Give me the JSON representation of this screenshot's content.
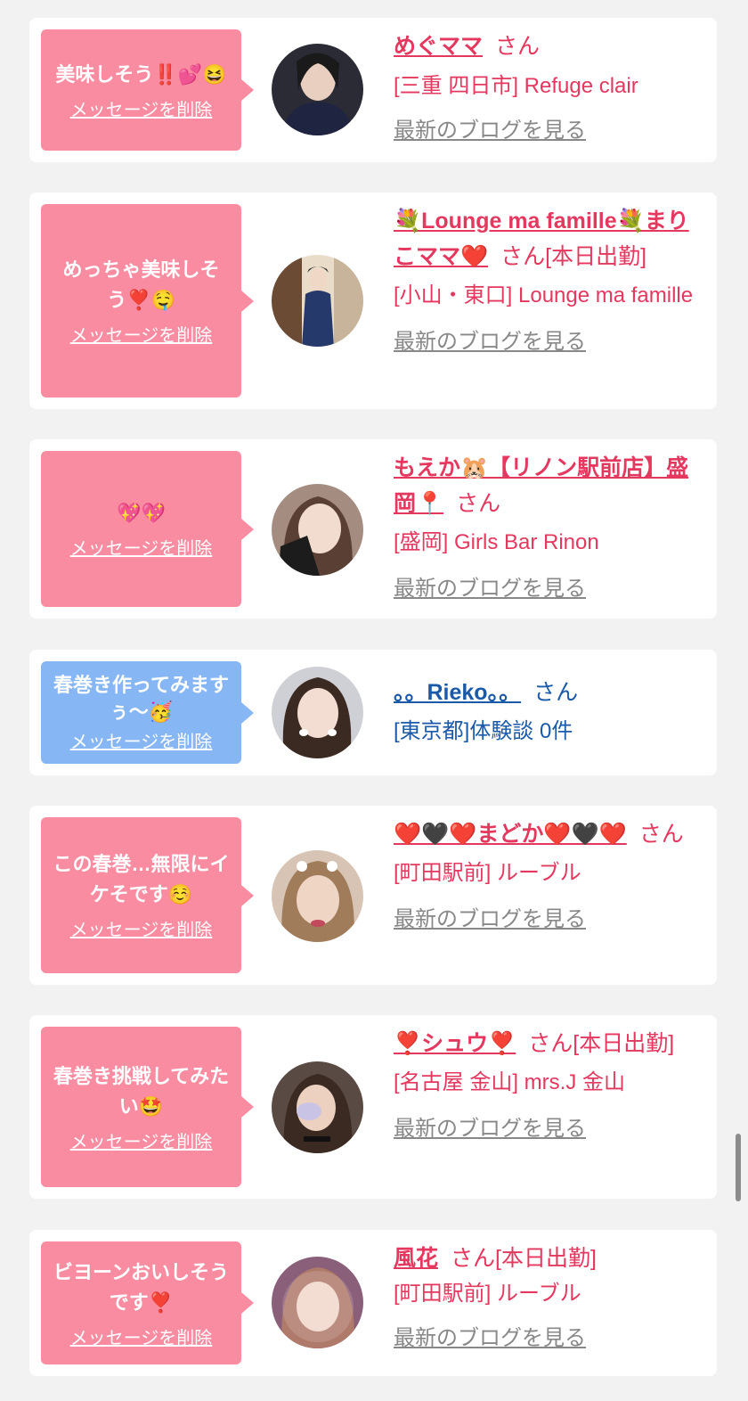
{
  "colors": {
    "background": "#f2f2f2",
    "bubble_pink": "#f98ca0",
    "bubble_blue": "#86b6f4",
    "name_pink": "#e5385f",
    "name_blue": "#1a5aa8",
    "blog_gray": "#888888"
  },
  "cards": [
    {
      "message": "美味しそう‼️💕😆",
      "delete_label": "メッセージを削除",
      "name": "めぐママ",
      "suffix": "さん",
      "location": "[三重 四日市] Refuge clair",
      "blog_label": "最新のブログを見る"
    },
    {
      "message": "めっちゃ美味しそう❣️🤤",
      "delete_label": "メッセージを削除",
      "name": "💐Lounge ma famille💐まりこママ❤️",
      "suffix": "さん[本日出勤]",
      "location": "[小山・東口] Lounge ma famille",
      "blog_label": "最新のブログを見る"
    },
    {
      "message": "💖💖",
      "delete_label": "メッセージを削除",
      "name": "もえか🐹【リノン駅前店】盛岡📍",
      "suffix": "さん",
      "location": "[盛岡] Girls Bar Rinon",
      "blog_label": "最新のブログを見る"
    },
    {
      "message": "春巻き作ってみますぅ〜🥳",
      "delete_label": "メッセージを削除",
      "name": "。。Rieko。。",
      "suffix": "さん",
      "location": "[東京都]体験談 0件",
      "blog_label": ""
    },
    {
      "message": "この春巻…無限にイケそです☺️",
      "delete_label": "メッセージを削除",
      "name": "❤️🖤❤️まどか❤️🖤❤️",
      "suffix": "さん",
      "location": "[町田駅前] ルーブル",
      "blog_label": "最新のブログを見る"
    },
    {
      "message": "春巻き挑戦してみたい🤩",
      "delete_label": "メッセージを削除",
      "name": "❣️シュウ❣️",
      "suffix": "さん[本日出勤]",
      "location": "[名古屋 金山] mrs.J 金山",
      "blog_label": "最新のブログを見る"
    },
    {
      "message": "ビヨーンおいしそうです❣️",
      "delete_label": "メッセージを削除",
      "name": "風花",
      "suffix": "さん[本日出勤]",
      "location": "[町田駅前] ルーブル",
      "blog_label": "最新のブログを見る"
    }
  ]
}
